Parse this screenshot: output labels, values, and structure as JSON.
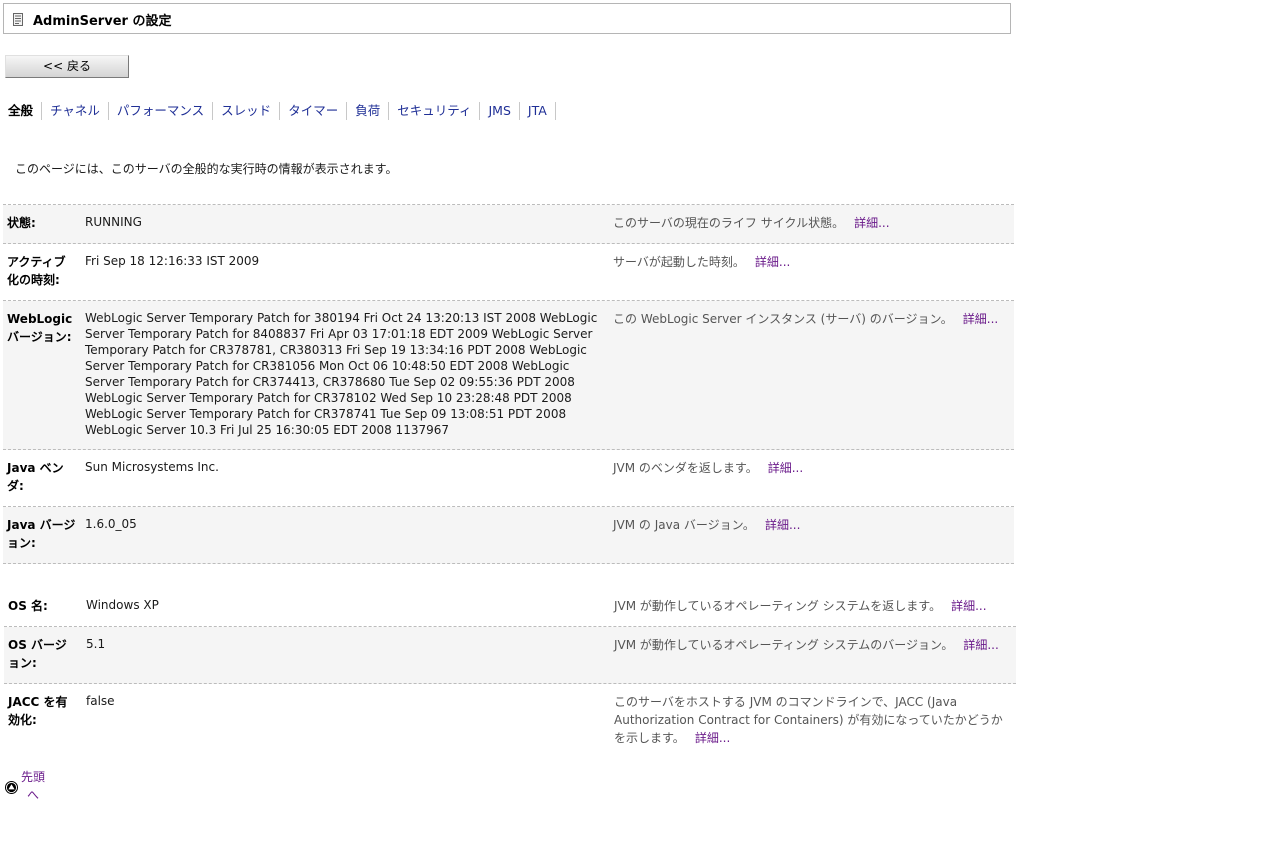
{
  "header": {
    "title": "AdminServer の設定",
    "icon": "server-config-icon"
  },
  "back_button": {
    "label": "<< 戻る"
  },
  "tabs": [
    {
      "label": "全般",
      "active": true
    },
    {
      "label": "チャネル",
      "active": false
    },
    {
      "label": "パフォーマンス",
      "active": false
    },
    {
      "label": "スレッド",
      "active": false
    },
    {
      "label": "タイマー",
      "active": false
    },
    {
      "label": "負荷",
      "active": false
    },
    {
      "label": "セキュリティ",
      "active": false
    },
    {
      "label": "JMS",
      "active": false
    },
    {
      "label": "JTA",
      "active": false
    }
  ],
  "intro": "このページには、このサーバの全般的な実行時の情報が表示されます。",
  "more_label": "詳細...",
  "rows": [
    {
      "label": "状態:",
      "value": "RUNNING",
      "desc": "このサーバの現在のライフ サイクル状態。"
    },
    {
      "label": "アクティブ化の時刻:",
      "value": "Fri Sep 18 12:16:33 IST 2009",
      "desc": "サーバが起動した時刻。"
    },
    {
      "label": "WebLogic バージョン:",
      "value": "WebLogic Server Temporary Patch for 380194 Fri Oct 24 13:20:13 IST 2008 WebLogic Server Temporary Patch for 8408837 Fri Apr 03 17:01:18 EDT 2009 WebLogic Server Temporary Patch for CR378781, CR380313 Fri Sep 19 13:34:16 PDT 2008 WebLogic Server Temporary Patch for CR381056 Mon Oct 06 10:48:50 EDT 2008 WebLogic Server Temporary Patch for CR374413, CR378680 Tue Sep 02 09:55:36 PDT 2008 WebLogic Server Temporary Patch for CR378102 Wed Sep 10 23:28:48 PDT 2008 WebLogic Server Temporary Patch for CR378741 Tue Sep 09 13:08:51 PDT 2008 WebLogic Server 10.3 Fri Jul 25 16:30:05 EDT 2008 1137967",
      "desc": "この WebLogic Server インスタンス (サーバ) のバージョン。"
    },
    {
      "label": "Java ベンダ:",
      "value": "Sun Microsystems Inc.",
      "desc": "JVM のベンダを返します。"
    },
    {
      "label": "Java バージョン:",
      "value": "1.6.0_05",
      "desc": "JVM の Java バージョン。"
    },
    {
      "label": "OS 名:",
      "value": "Windows XP",
      "desc": "JVM が動作しているオペレーティング システムを返します。"
    },
    {
      "label": "OS バージョン:",
      "value": "5.1",
      "desc": "JVM が動作しているオペレーティング システムのバージョン。"
    },
    {
      "label": "JACC を有効化:",
      "value": "false",
      "desc": "このサーバをホストする JVM のコマンドラインで、JACC (Java Authorization Contract for Containers) が有効になっていたかどうかを示します。"
    }
  ],
  "footer": {
    "top_link": "先頭へ",
    "icon": "scroll-top-icon"
  }
}
